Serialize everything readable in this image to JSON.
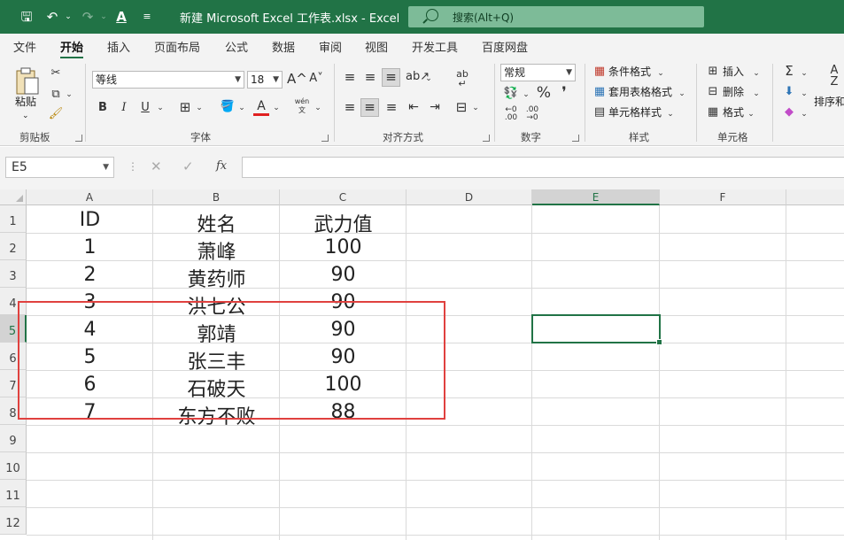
{
  "window": {
    "title": "新建 Microsoft Excel 工作表.xlsx  -  Excel",
    "search_placeholder": "搜索(Alt+Q)"
  },
  "menu": {
    "tabs": [
      "文件",
      "开始",
      "插入",
      "页面布局",
      "公式",
      "数据",
      "审阅",
      "视图",
      "开发工具",
      "百度网盘"
    ],
    "active": "开始"
  },
  "ribbon": {
    "clipboard": {
      "label": "剪贴板",
      "paste": "粘贴"
    },
    "font": {
      "label": "字体",
      "name": "等线",
      "size": "18",
      "bold": "B",
      "italic": "I",
      "underline": "U",
      "grow": "A^",
      "shrink": "A˅",
      "color": "A",
      "wen": "wén 文"
    },
    "alignment": {
      "label": "对齐方式"
    },
    "number": {
      "label": "数字",
      "format": "常规"
    },
    "styles": {
      "label": "样式",
      "conditional": "条件格式",
      "table": "套用表格格式",
      "cell": "单元格样式"
    },
    "cells": {
      "label": "单元格",
      "insert": "插入",
      "delete": "删除",
      "format": "格式"
    },
    "editing": {
      "sort": "排序和"
    }
  },
  "formula_bar": {
    "name_box": "E5",
    "formula": ""
  },
  "columns": [
    "A",
    "B",
    "C",
    "D",
    "E",
    "F"
  ],
  "rows": [
    "1",
    "2",
    "3",
    "4",
    "5",
    "6",
    "7",
    "8",
    "9",
    "10",
    "11",
    "12"
  ],
  "selected": {
    "column": "E",
    "row": "5"
  },
  "table": [
    [
      "ID",
      "姓名",
      "武力值"
    ],
    [
      "1",
      "萧峰",
      "100"
    ],
    [
      "2",
      "黄药师",
      "90"
    ],
    [
      "3",
      "洪七公",
      "90"
    ],
    [
      "4",
      "郭靖",
      "90"
    ],
    [
      "5",
      "张三丰",
      "90"
    ],
    [
      "6",
      "石破天",
      "100"
    ],
    [
      "7",
      "东方不败",
      "88"
    ]
  ],
  "colors": {
    "brand": "#217346",
    "highlight_box": "#e0413f"
  }
}
